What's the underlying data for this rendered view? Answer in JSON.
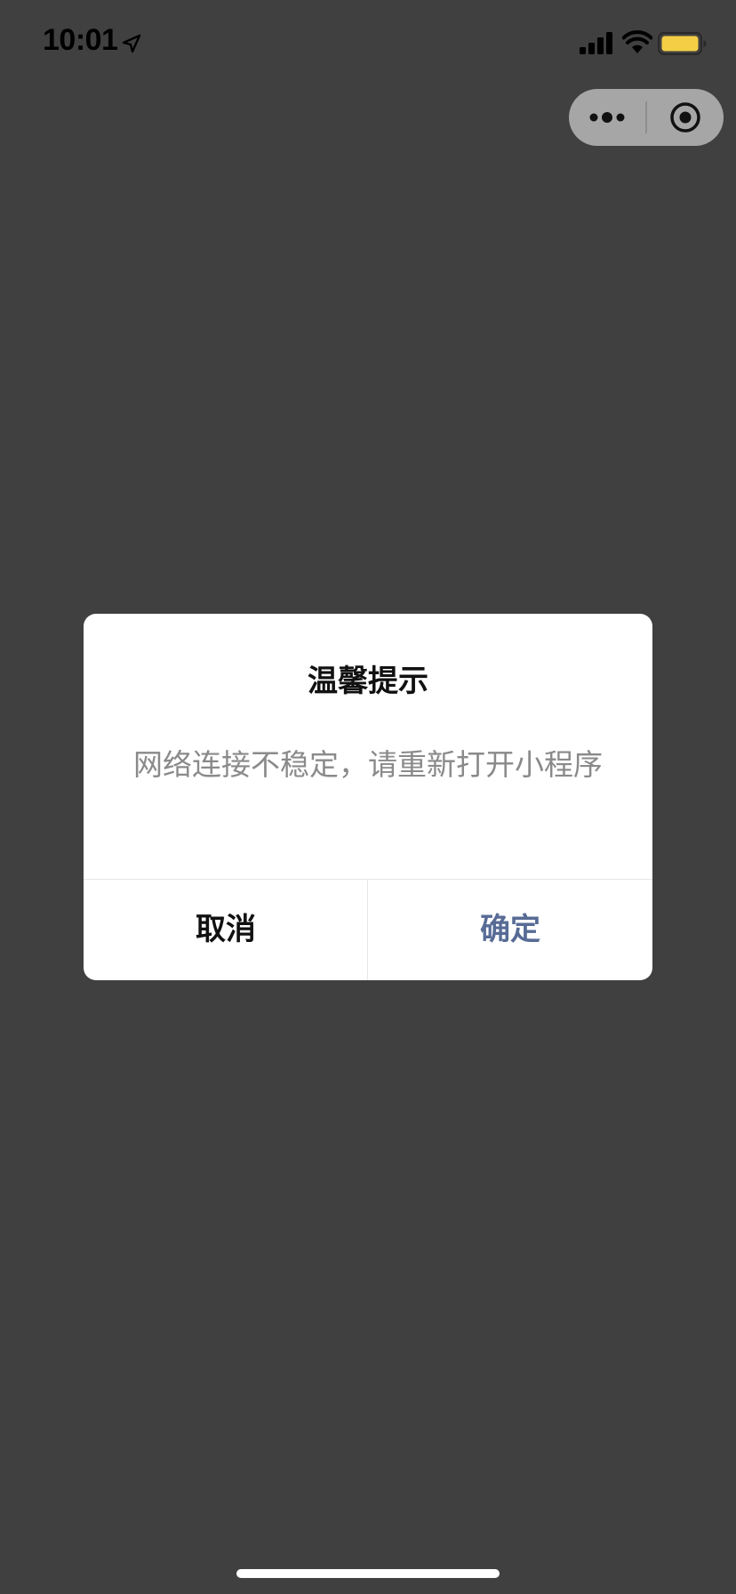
{
  "status_bar": {
    "time": "10:01",
    "icons": [
      "location-arrow-icon",
      "cellular-signal-icon",
      "wifi-icon",
      "battery-icon"
    ],
    "battery_color": "#f4cf46"
  },
  "capsule": {
    "more_icon": "more-dots-icon",
    "close_icon": "close-target-icon"
  },
  "dialog": {
    "title": "温馨提示",
    "message": "网络连接不稳定，请重新打开小程序",
    "cancel_label": "取消",
    "confirm_label": "确定",
    "confirm_color": "#576b95"
  },
  "colors": {
    "overlay_background": "#404040",
    "dialog_background": "#ffffff",
    "message_text": "#8a8a8a"
  }
}
